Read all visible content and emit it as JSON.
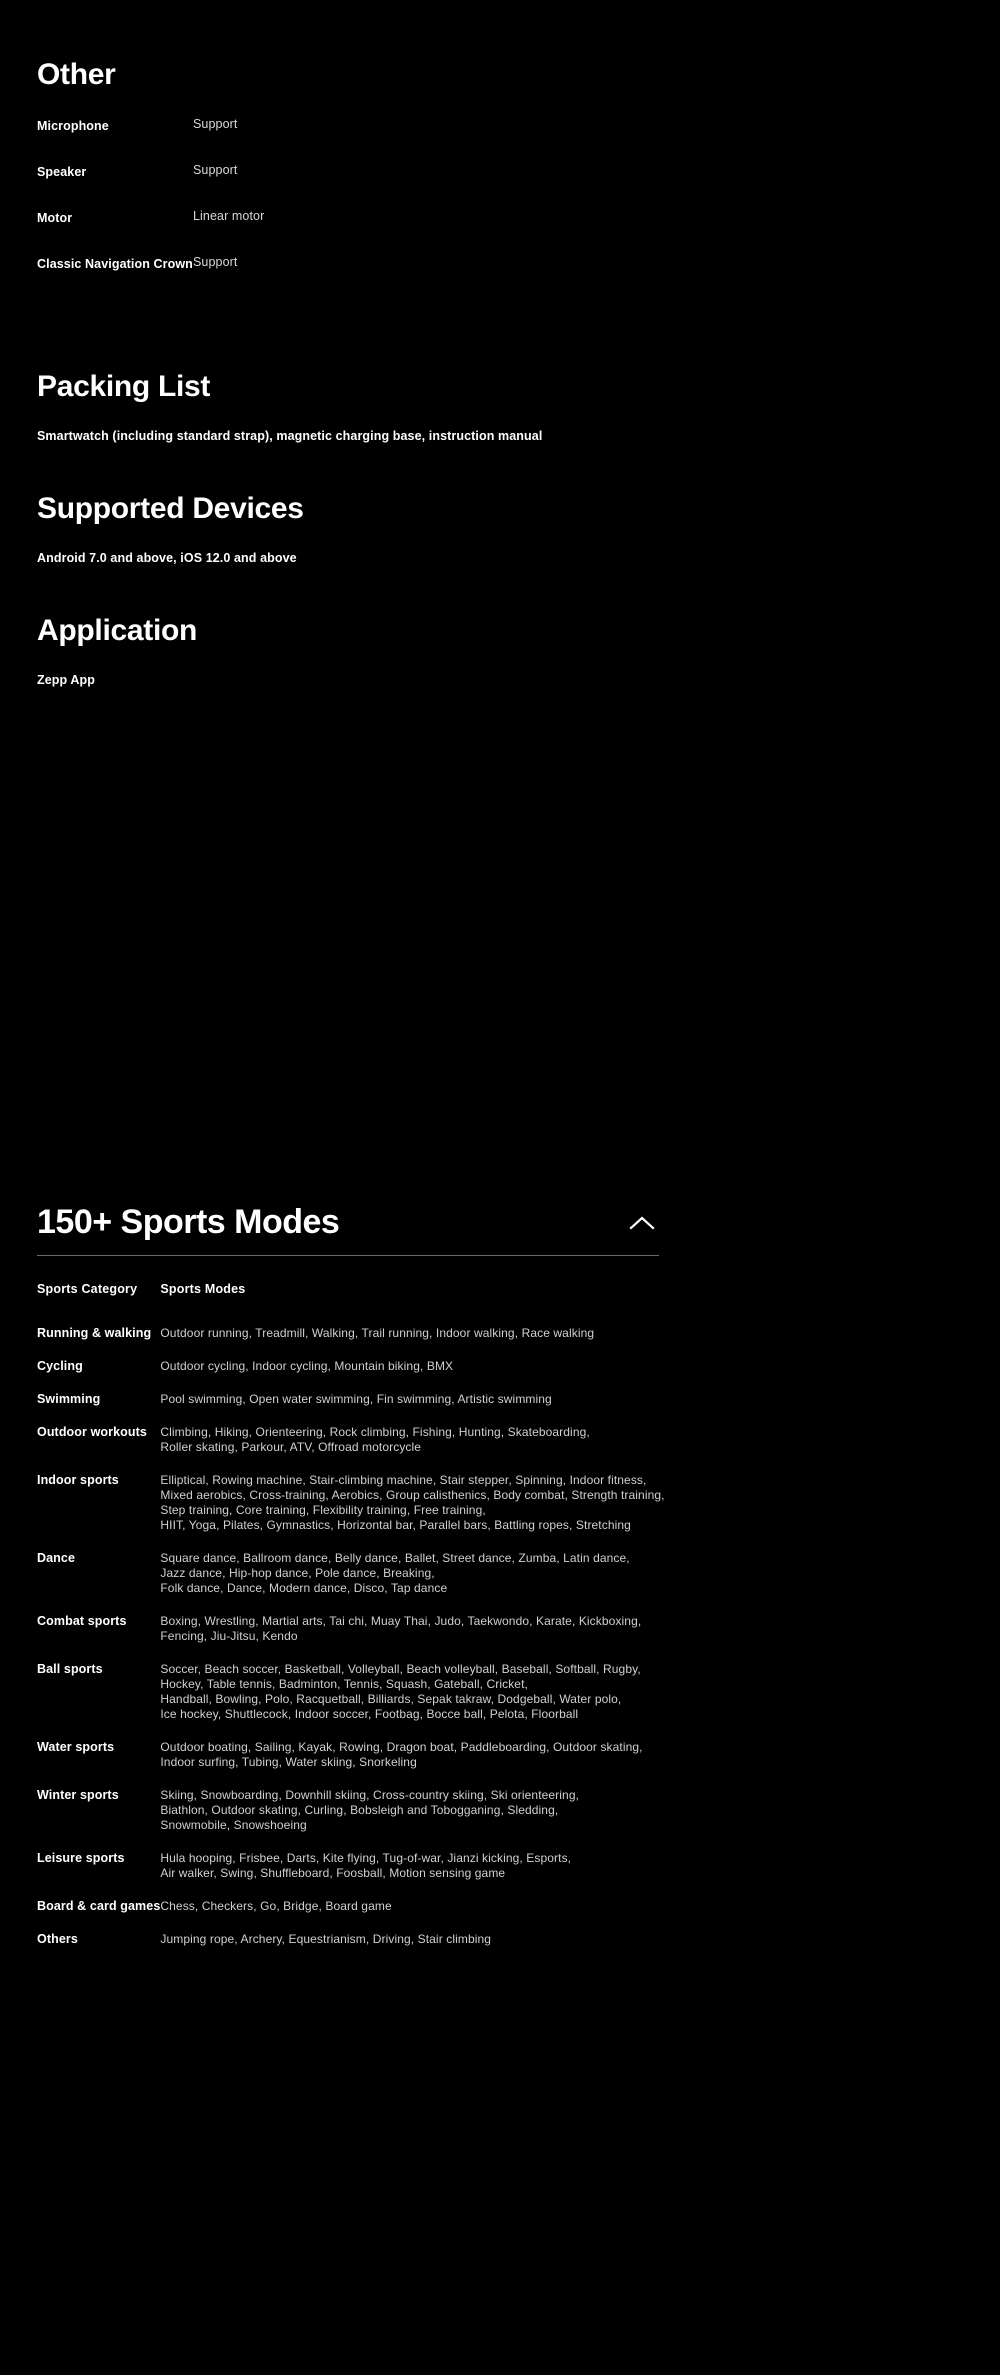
{
  "colors": {
    "background": "#000000",
    "text_primary": "#ffffff",
    "text_secondary": "#d0d0d0",
    "divider": "#6b6b6b"
  },
  "other_section": {
    "title": "Other",
    "rows": [
      {
        "label": "Microphone",
        "value": "Support"
      },
      {
        "label": "Speaker",
        "value": "Support"
      },
      {
        "label": "Motor",
        "value": "Linear motor"
      },
      {
        "label": "Classic Navigation Crown",
        "value": "Support"
      }
    ]
  },
  "packing_list": {
    "title": "Packing List",
    "body": "Smartwatch (including standard strap), magnetic charging base, instruction manual"
  },
  "supported_devices": {
    "title": "Supported Devices",
    "body": "Android 7.0 and above, iOS 12.0 and above"
  },
  "application": {
    "title": "Application",
    "body": "Zepp App"
  },
  "sports_modes": {
    "heading": "150+ Sports Modes",
    "toggle_icon": "chevron-up-icon",
    "columns": [
      "Sports Category",
      "Sports Modes"
    ],
    "rows": [
      {
        "category": "Running & walking",
        "modes": [
          "Outdoor running, Treadmill, Walking, Trail running, Indoor walking, Race walking"
        ]
      },
      {
        "category": "Cycling",
        "modes": [
          "Outdoor cycling, Indoor cycling, Mountain biking, BMX"
        ]
      },
      {
        "category": "Swimming",
        "modes": [
          "Pool swimming, Open water swimming, Fin swimming, Artistic swimming"
        ]
      },
      {
        "category": "Outdoor workouts",
        "modes": [
          "Climbing, Hiking, Orienteering, Rock climbing, Fishing, Hunting, Skateboarding,",
          "Roller skating, Parkour, ATV, Offroad motorcycle"
        ]
      },
      {
        "category": "Indoor sports",
        "modes": [
          "Elliptical, Rowing machine, Stair-climbing machine, Stair stepper, Spinning, Indoor fitness,",
          "Mixed aerobics, Cross-training, Aerobics, Group calisthenics, Body combat, Strength training,",
          "Step training, Core training, Flexibility training, Free training,",
          "HIIT, Yoga, Pilates, Gymnastics, Horizontal bar, Parallel bars, Battling ropes, Stretching"
        ]
      },
      {
        "category": "Dance",
        "modes": [
          "Square dance, Ballroom dance, Belly dance, Ballet, Street dance, Zumba, Latin dance,",
          "Jazz dance, Hip-hop dance, Pole dance, Breaking,",
          "Folk dance, Dance, Modern dance, Disco, Tap dance"
        ]
      },
      {
        "category": "Combat sports",
        "modes": [
          "Boxing, Wrestling, Martial arts, Tai chi, Muay Thai, Judo, Taekwondo, Karate, Kickboxing,",
          "Fencing, Jiu-Jitsu, Kendo"
        ]
      },
      {
        "category": "Ball sports",
        "modes": [
          "Soccer, Beach soccer, Basketball, Volleyball, Beach volleyball, Baseball, Softball, Rugby,",
          "Hockey, Table tennis, Badminton, Tennis, Squash, Gateball, Cricket,",
          "Handball, Bowling, Polo, Racquetball, Billiards, Sepak takraw, Dodgeball, Water polo,",
          "Ice hockey, Shuttlecock, Indoor soccer, Footbag, Bocce ball, Pelota, Floorball"
        ]
      },
      {
        "category": "Water sports",
        "modes": [
          "Outdoor boating, Sailing, Kayak, Rowing, Dragon boat, Paddleboarding, Outdoor skating,",
          "Indoor surfing, Tubing, Water skiing, Snorkeling"
        ]
      },
      {
        "category": "Winter sports",
        "modes": [
          "Skiing, Snowboarding, Downhill skiing, Cross-country skiing, Ski orienteering,",
          "Biathlon, Outdoor skating, Curling, Bobsleigh and Tobogganing, Sledding,",
          "Snowmobile, Snowshoeing"
        ]
      },
      {
        "category": "Leisure sports",
        "modes": [
          "Hula hooping, Frisbee, Darts, Kite flying, Tug-of-war, Jianzi kicking, Esports,",
          "Air walker, Swing, Shuffleboard, Foosball, Motion sensing game"
        ]
      },
      {
        "category": "Board & card games",
        "modes": [
          "Chess, Checkers, Go, Bridge, Board game"
        ]
      },
      {
        "category": "Others",
        "modes": [
          "Jumping rope, Archery, Equestrianism, Driving, Stair climbing"
        ]
      }
    ]
  }
}
